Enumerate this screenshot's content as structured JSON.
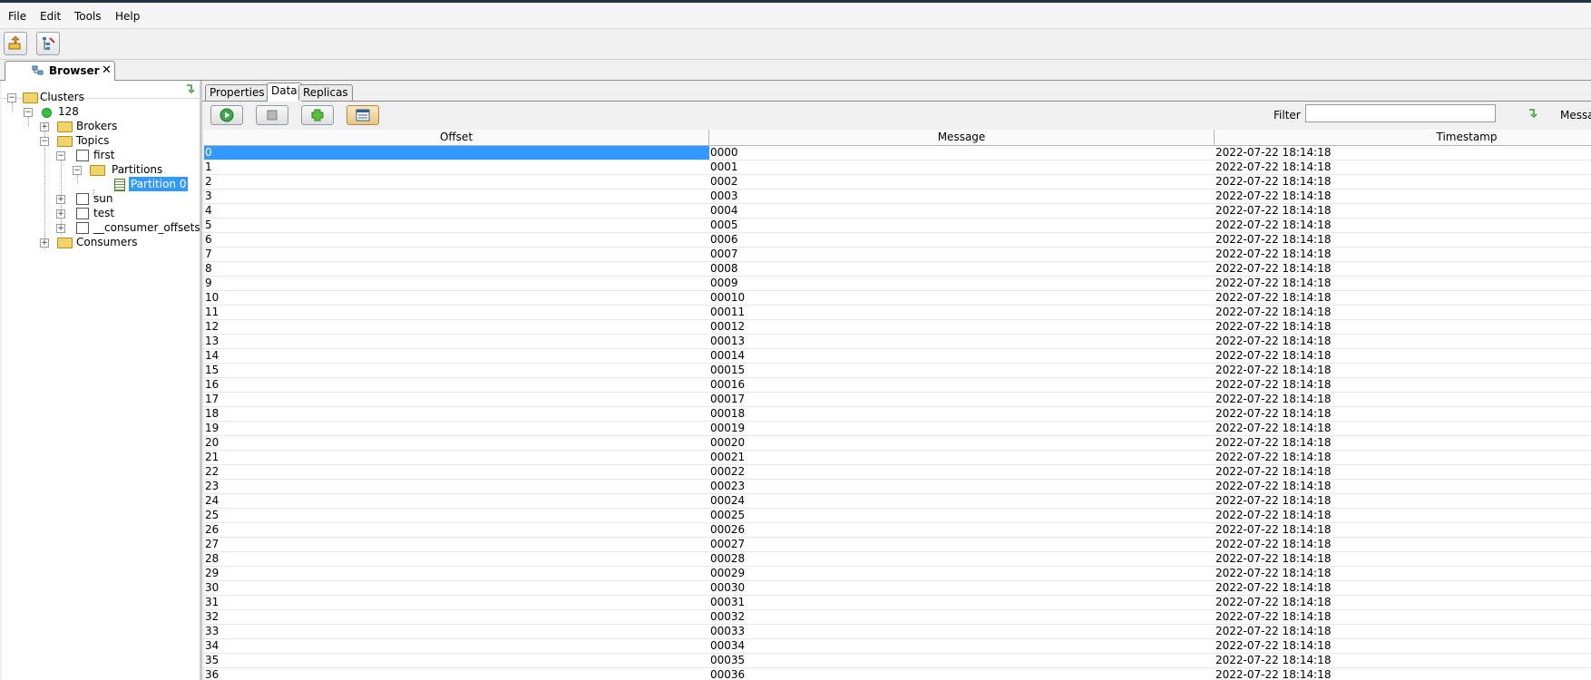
{
  "menu": {
    "file": "File",
    "edit": "Edit",
    "tools": "Tools",
    "help": "Help"
  },
  "toolbar": {
    "btn1_icon": "connect-icon",
    "btn2_icon": "tree-edit-icon"
  },
  "tab": {
    "label": "Browser",
    "close": "✕",
    "icon": "browser-icon"
  },
  "tree": {
    "root": "Clusters",
    "cluster": "128",
    "brokers": "Brokers",
    "topics": "Topics",
    "first": "first",
    "partitions": "Partitions",
    "partition0": "Partition 0",
    "sun": "sun",
    "test": "test",
    "consumer_offsets": "__consumer_offsets",
    "consumers": "Consumers"
  },
  "subtabs": {
    "properties": "Properties",
    "data": "Data",
    "replicas": "Replicas"
  },
  "data_toolbar": {
    "filter_label": "Filter",
    "filter_value": "",
    "message_label": "Messa"
  },
  "table": {
    "columns": [
      "Offset",
      "Message",
      "Timestamp"
    ],
    "rows": [
      [
        "0",
        "0000",
        "2022-07-22 18:14:18"
      ],
      [
        "1",
        "0001",
        "2022-07-22 18:14:18"
      ],
      [
        "2",
        "0002",
        "2022-07-22 18:14:18"
      ],
      [
        "3",
        "0003",
        "2022-07-22 18:14:18"
      ],
      [
        "4",
        "0004",
        "2022-07-22 18:14:18"
      ],
      [
        "5",
        "0005",
        "2022-07-22 18:14:18"
      ],
      [
        "6",
        "0006",
        "2022-07-22 18:14:18"
      ],
      [
        "7",
        "0007",
        "2022-07-22 18:14:18"
      ],
      [
        "8",
        "0008",
        "2022-07-22 18:14:18"
      ],
      [
        "9",
        "0009",
        "2022-07-22 18:14:18"
      ],
      [
        "10",
        "00010",
        "2022-07-22 18:14:18"
      ],
      [
        "11",
        "00011",
        "2022-07-22 18:14:18"
      ],
      [
        "12",
        "00012",
        "2022-07-22 18:14:18"
      ],
      [
        "13",
        "00013",
        "2022-07-22 18:14:18"
      ],
      [
        "14",
        "00014",
        "2022-07-22 18:14:18"
      ],
      [
        "15",
        "00015",
        "2022-07-22 18:14:18"
      ],
      [
        "16",
        "00016",
        "2022-07-22 18:14:18"
      ],
      [
        "17",
        "00017",
        "2022-07-22 18:14:18"
      ],
      [
        "18",
        "00018",
        "2022-07-22 18:14:18"
      ],
      [
        "19",
        "00019",
        "2022-07-22 18:14:18"
      ],
      [
        "20",
        "00020",
        "2022-07-22 18:14:18"
      ],
      [
        "21",
        "00021",
        "2022-07-22 18:14:18"
      ],
      [
        "22",
        "00022",
        "2022-07-22 18:14:18"
      ],
      [
        "23",
        "00023",
        "2022-07-22 18:14:18"
      ],
      [
        "24",
        "00024",
        "2022-07-22 18:14:18"
      ],
      [
        "25",
        "00025",
        "2022-07-22 18:14:18"
      ],
      [
        "26",
        "00026",
        "2022-07-22 18:14:18"
      ],
      [
        "27",
        "00027",
        "2022-07-22 18:14:18"
      ],
      [
        "28",
        "00028",
        "2022-07-22 18:14:18"
      ],
      [
        "29",
        "00029",
        "2022-07-22 18:14:18"
      ],
      [
        "30",
        "00030",
        "2022-07-22 18:14:18"
      ],
      [
        "31",
        "00031",
        "2022-07-22 18:14:18"
      ],
      [
        "32",
        "00032",
        "2022-07-22 18:14:18"
      ],
      [
        "33",
        "00033",
        "2022-07-22 18:14:18"
      ],
      [
        "34",
        "00034",
        "2022-07-22 18:14:18"
      ],
      [
        "35",
        "00035",
        "2022-07-22 18:14:18"
      ],
      [
        "36",
        "00036",
        "2022-07-22 18:14:18"
      ]
    ]
  }
}
